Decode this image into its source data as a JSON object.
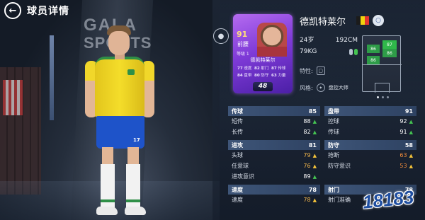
{
  "header": {
    "title": "球员详情",
    "back_icon": "back-arrow-icon"
  },
  "stage": {
    "brand_line1": "GALA",
    "brand_line2": "SPORTS",
    "jersey_number": "17"
  },
  "card": {
    "rating": "91",
    "position": "前腰",
    "level": "等级 1",
    "name": "德凯特莱尔",
    "stats": [
      {
        "value": "77",
        "label": "速度"
      },
      {
        "value": "82",
        "label": "射门"
      },
      {
        "value": "87",
        "label": "传球"
      },
      {
        "value": "84",
        "label": "盘带"
      },
      {
        "value": "80",
        "label": "防守"
      },
      {
        "value": "63",
        "label": "力量"
      }
    ],
    "badge": "48"
  },
  "player": {
    "name": "德凯特莱尔",
    "flag_colors": [
      "#1b1b1b",
      "#f1d20e",
      "#e3342f"
    ],
    "age": "24岁",
    "height": "192CM",
    "weight": "79KG",
    "trait_label": "特性:",
    "style_label": "风格:",
    "style_value": "盘控大师"
  },
  "position_map": {
    "zones": [
      {
        "value": "87",
        "level": "high"
      },
      {
        "value": "86",
        "level": "mid"
      },
      {
        "value": "86",
        "level": "mid"
      },
      {
        "value": "86",
        "level": "mid"
      }
    ],
    "page_dots": 3,
    "active_dot": 1
  },
  "stats": [
    {
      "name": "传球",
      "value": "85",
      "subs": [
        {
          "name": "短传",
          "value": "88",
          "trend": "up",
          "tone": "good"
        },
        {
          "name": "长传",
          "value": "82",
          "trend": "up",
          "tone": "good"
        }
      ]
    },
    {
      "name": "盘带",
      "value": "91",
      "subs": [
        {
          "name": "控球",
          "value": "92",
          "trend": "up",
          "tone": "good"
        },
        {
          "name": "传球",
          "value": "91",
          "trend": "up",
          "tone": "good"
        }
      ]
    },
    {
      "name": "进攻",
      "value": "81",
      "subs": [
        {
          "name": "头球",
          "value": "79",
          "trend": "up",
          "tone": "mid"
        },
        {
          "name": "任意球",
          "value": "76",
          "trend": "up",
          "tone": "mid"
        },
        {
          "name": "进攻意识",
          "value": "89",
          "trend": "up",
          "tone": "good"
        }
      ]
    },
    {
      "name": "防守",
      "value": "58",
      "subs": [
        {
          "name": "抢断",
          "value": "63",
          "trend": "up",
          "tone": "warn"
        },
        {
          "name": "防守意识",
          "value": "53",
          "trend": "up",
          "tone": "warn"
        }
      ]
    },
    {
      "name": "速度",
      "value": "78",
      "subs": [
        {
          "name": "速度",
          "value": "78",
          "trend": "up",
          "tone": "mid"
        }
      ]
    },
    {
      "name": "射门",
      "value": "78",
      "subs": [
        {
          "name": "射门准确",
          "value": "",
          "trend": "",
          "tone": "mid"
        }
      ]
    }
  ],
  "watermark": "18183"
}
